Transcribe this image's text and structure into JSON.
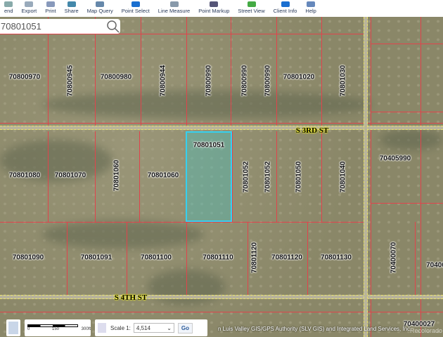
{
  "toolbar": {
    "items": [
      {
        "label": "end",
        "icon": "legend-icon"
      },
      {
        "label": "Export",
        "icon": "export-icon"
      },
      {
        "label": "Print",
        "icon": "print-icon"
      },
      {
        "label": "Share",
        "icon": "share-icon"
      },
      {
        "label": "Map Query",
        "icon": "search-icon"
      },
      {
        "label": "Point Select",
        "icon": "info-icon"
      },
      {
        "label": "Line Measure",
        "icon": "ruler-icon"
      },
      {
        "label": "Point Markup",
        "icon": "pin-icon"
      },
      {
        "label": "Street View",
        "icon": "street-view-icon"
      },
      {
        "label": "Client Info",
        "icon": "info-icon"
      },
      {
        "label": "Help",
        "icon": "help-icon"
      }
    ]
  },
  "search": {
    "value": "70801051"
  },
  "streets": {
    "s3rd": "S 3RD ST",
    "s4th": "S 4TH ST"
  },
  "selected_parcel": "70801051",
  "parcels": [
    "70800970",
    "70800945",
    "70800980",
    "70800944",
    "70800990",
    "70800990",
    "70800990",
    "70801020",
    "70801030",
    "70801080",
    "70801070",
    "70801060",
    "70801060",
    "70801052",
    "70801052",
    "70801050",
    "70801040",
    "70405990",
    "70801090",
    "70801091",
    "70801100",
    "70801110",
    "70801120",
    "70801120",
    "70801130",
    "70400070",
    "70400",
    "70400027"
  ],
  "scalebar": {
    "ticks": [
      "0",
      "150",
      "300ft"
    ]
  },
  "scale": {
    "label": "Scale 1:",
    "value": "4,514",
    "go": "Go"
  },
  "attribution": "n Luis Valley GIS/GPS Authority (SLV GIS) and Integrated Land Services, Inc.",
  "watermark": "Recolorado",
  "colors": {
    "parcel_line": "#e0444c",
    "selection": "#35d0f0",
    "road_dash": "#e9e36a"
  }
}
